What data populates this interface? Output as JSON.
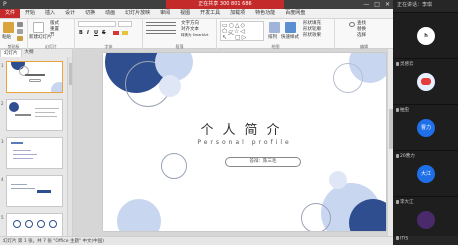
{
  "window": {
    "title_badge": "正在共享 300 801 686",
    "quick_access": "P",
    "controls": [
      "—",
      "□",
      "✕"
    ]
  },
  "ribbon_tabs": [
    {
      "label": "文件",
      "active": true
    },
    {
      "label": "开始"
    },
    {
      "label": "插入"
    },
    {
      "label": "设计"
    },
    {
      "label": "切换"
    },
    {
      "label": "动画"
    },
    {
      "label": "幻灯片放映"
    },
    {
      "label": "审阅"
    },
    {
      "label": "视图"
    },
    {
      "label": "开发工具"
    },
    {
      "label": "加载项"
    },
    {
      "label": "特色功能"
    },
    {
      "label": "百度网盘"
    }
  ],
  "ribbon": {
    "clipboard": {
      "paste": "粘贴",
      "group": "剪贴板"
    },
    "slides": {
      "new_slide": "新建幻灯片",
      "layout": "版式",
      "reset": "重置",
      "section": "节",
      "group": "幻灯片"
    },
    "font": {
      "font_name": "",
      "font_size": "",
      "bold": "B",
      "italic": "I",
      "underline": "U",
      "strike": "S",
      "group": "字体"
    },
    "paragraph": {
      "text_direction": "文字方向",
      "align_text": "对齐文本",
      "smartart": "转换为 SmartArt",
      "group": "段落"
    },
    "drawing": {
      "arrange": "排列",
      "quick_styles": "快速样式",
      "shape_fill": "形状填充",
      "shape_outline": "形状轮廓",
      "shape_effects": "形状效果",
      "group": "绘图"
    },
    "editing": {
      "find": "查找",
      "replace": "替换",
      "select": "选择",
      "group": "编辑"
    }
  },
  "pane": {
    "tabs": [
      "幻灯片",
      "大纲"
    ],
    "thumb_numbers": [
      "1",
      "2",
      "3",
      "4",
      "5"
    ]
  },
  "slide": {
    "title": "个人简介",
    "subtitle": "Personal profile",
    "presenter": "答辩：陈三毛"
  },
  "status_bar": {
    "text": "幻灯片 第 1 张，共 7 张   \"Office 主题\"   中文(中国)"
  },
  "side_panel": {
    "header": "正在讲话：李琪",
    "participants": [
      {
        "name": "",
        "avatar_text": "h",
        "avatar_color": "#ffffff"
      },
      {
        "name": "灵感云",
        "avatar_text": "",
        "avatar_color": "#e6f0ff"
      },
      {
        "name": "抽虫",
        "avatar_text": "曹力",
        "avatar_color": "#1e6fe8"
      },
      {
        "name": "20曹力",
        "avatar_text": "大江",
        "avatar_color": "#1e6fe8"
      },
      {
        "name": "李大江",
        "avatar_text": "",
        "avatar_color": "#4a2a6a"
      },
      {
        "name": "ITIS",
        "avatar_text": "",
        "avatar_color": "#2a2a2a"
      }
    ]
  },
  "colors": {
    "accent_red": "#c52a2a",
    "navy": "#2f4e8f",
    "light_blue": "#c8d6f0",
    "meeting_blue": "#1e6fe8"
  }
}
